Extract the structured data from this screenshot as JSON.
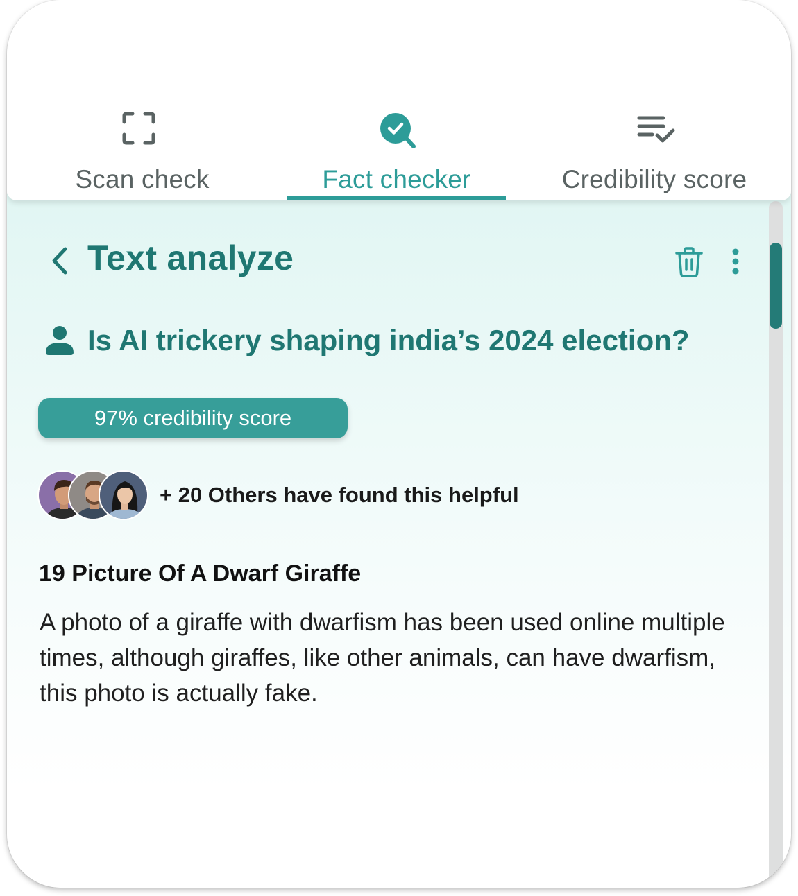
{
  "tabs": [
    {
      "label": "Scan check",
      "icon": "scan-frame-icon",
      "active": false
    },
    {
      "label": "Fact checker",
      "icon": "search-check-icon",
      "active": true
    },
    {
      "label": "Credibility score",
      "icon": "checklist-icon",
      "active": false
    }
  ],
  "header": {
    "title": "Text analyze",
    "back_icon": "chevron-left-icon",
    "delete_icon": "trash-icon",
    "more_icon": "more-vertical-icon"
  },
  "query": {
    "icon": "person-icon",
    "text": "Is AI trickery shaping india’s 2024 election?"
  },
  "credibility": {
    "label": "97% credibility score",
    "percent": 97
  },
  "helpful": {
    "text": "+ 20 Others have found this helpful",
    "avatars": [
      "avatar-1",
      "avatar-2",
      "avatar-3"
    ]
  },
  "article": {
    "title": "19 Picture Of A Dwarf Giraffe",
    "body": "A photo of a giraffe with dwarfism has been used online multiple times, although giraffes, like other animals, can have dwarfism, this photo is actually fake."
  },
  "colors": {
    "accent": "#2d9c98",
    "accent_dark": "#1f7772",
    "panel_bg": "#e1f6f3",
    "scroll_thumb": "#247b77"
  }
}
